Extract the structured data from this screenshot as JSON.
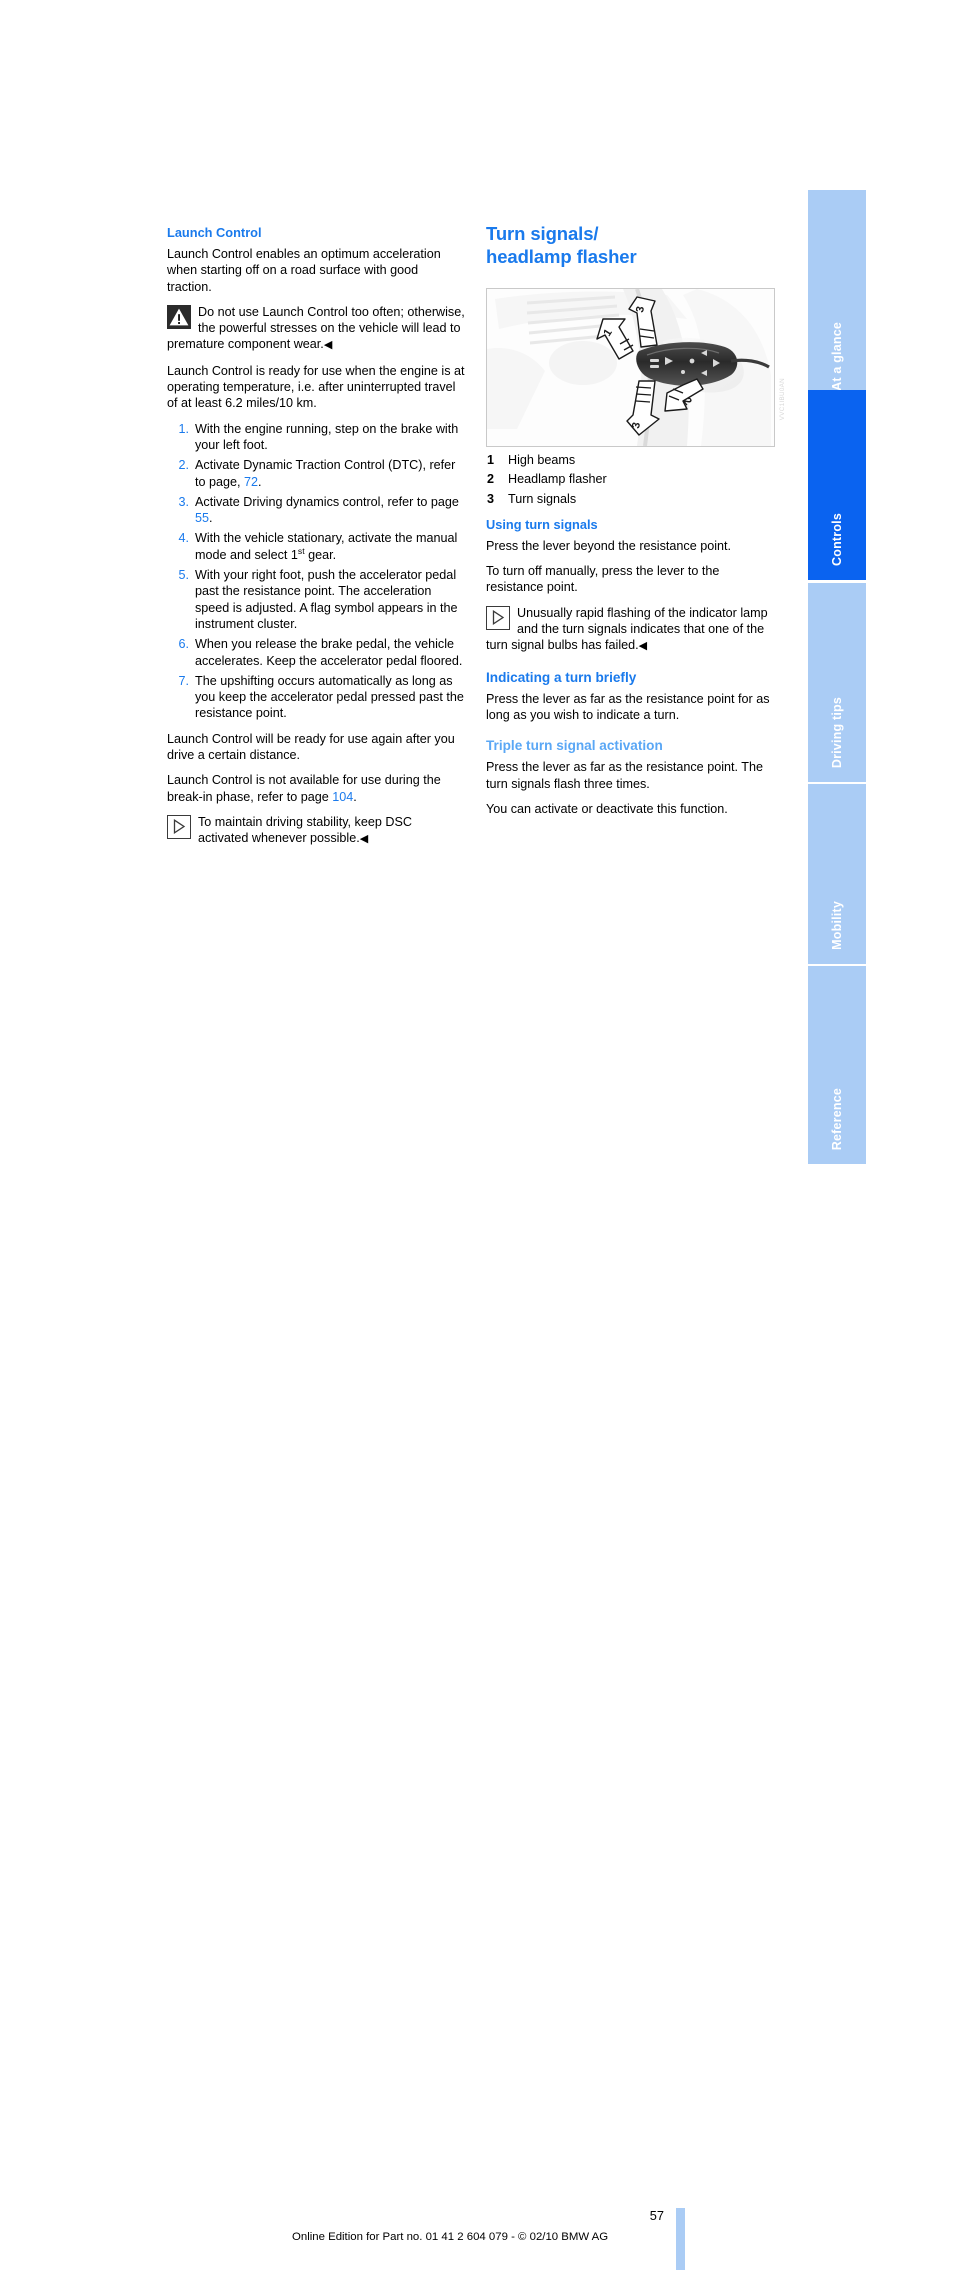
{
  "document": {
    "page_number": "57",
    "footer_text": "Online Edition for Part no. 01 41 2 604 079 - © 02/10 BMW AG",
    "figure_caption_code": "VVC1IBU0AN"
  },
  "tabs": [
    {
      "label": "At a glance",
      "active": false
    },
    {
      "label": "Controls",
      "active": true
    },
    {
      "label": "Driving tips",
      "active": false
    },
    {
      "label": "Mobility",
      "active": false
    },
    {
      "label": "Reference",
      "active": false
    }
  ],
  "left_column": {
    "heading": "Launch Control",
    "intro": "Launch Control enables an optimum acceleration when starting off on a road surface with good traction.",
    "warning": {
      "icon": "warning-triangle-icon",
      "text": "Do not use Launch Control too often; otherwise, the powerful stresses on the vehicle will lead to premature component wear.",
      "endmark": "◀"
    },
    "readiness": "Launch Control is ready for use when the engine is at operating temperature, i.e. after uninterrupted travel of at least 6.2 miles/10 km.",
    "steps": [
      {
        "num": "1.",
        "text": "With the engine running, step on the brake with your left foot."
      },
      {
        "num": "2.",
        "text_before": "Activate Dynamic Traction Control (DTC), refer to page, ",
        "link": "72",
        "text_after": "."
      },
      {
        "num": "3.",
        "text_before": "Activate Driving dynamics control, refer to page ",
        "link": "55",
        "text_after": "."
      },
      {
        "num": "4.",
        "text_before": "With the vehicle stationary, activate the manual mode and select 1",
        "sup": "st",
        "text_after": " gear."
      },
      {
        "num": "5.",
        "text": "With your right foot, push the accelerator pedal past the resistance point. The acceleration speed is adjusted. A flag symbol appears in the instrument cluster."
      },
      {
        "num": "6.",
        "text": "When you release the brake pedal, the vehicle accelerates. Keep the accelerator pedal floored."
      },
      {
        "num": "7.",
        "text": "The upshifting occurs automatically as long as you keep the accelerator pedal pressed past the resistance point."
      }
    ],
    "after_steps": "Launch Control will be ready for use again after you drive a certain distance.",
    "break_in": {
      "text_before": "Launch Control is not available for use during the break-in phase, refer to page ",
      "link": "104",
      "text_after": "."
    },
    "note": {
      "icon": "note-triangle-icon",
      "text": "To maintain driving stability, keep DSC activated whenever possible.",
      "endmark": "◀"
    }
  },
  "right_column": {
    "heading_line1": "Turn signals/",
    "heading_line2": "headlamp flasher",
    "figure": {
      "name": "turn-signal-stalk-illustration",
      "callouts": [
        "1",
        "2",
        "3",
        "3"
      ]
    },
    "legend": [
      {
        "num": "1",
        "label": "High beams"
      },
      {
        "num": "2",
        "label": "Headlamp flasher"
      },
      {
        "num": "3",
        "label": "Turn signals"
      }
    ],
    "using": {
      "heading": "Using turn signals",
      "p1": "Press the lever beyond the resistance point.",
      "p2": "To turn off manually, press the lever to the resistance point.",
      "note": {
        "icon": "note-triangle-icon",
        "text": "Unusually rapid flashing of the indicator lamp and the turn signals indicates that one of the turn signal bulbs has failed.",
        "endmark": "◀"
      }
    },
    "briefly": {
      "heading": "Indicating a turn briefly",
      "p1": "Press the lever as far as the resistance point for as long as you wish to indicate a turn."
    },
    "triple": {
      "heading": "Triple turn signal activation",
      "p1": "Press the lever as far as the resistance point. The turn signals flash three times.",
      "p2": "You can activate or deactivate this function."
    }
  },
  "colors": {
    "accent_blue": "#1a7aec",
    "pale_blue": "#5aa7f5",
    "tab_inactive": "#aaccf5",
    "tab_active": "#0a63f0"
  }
}
